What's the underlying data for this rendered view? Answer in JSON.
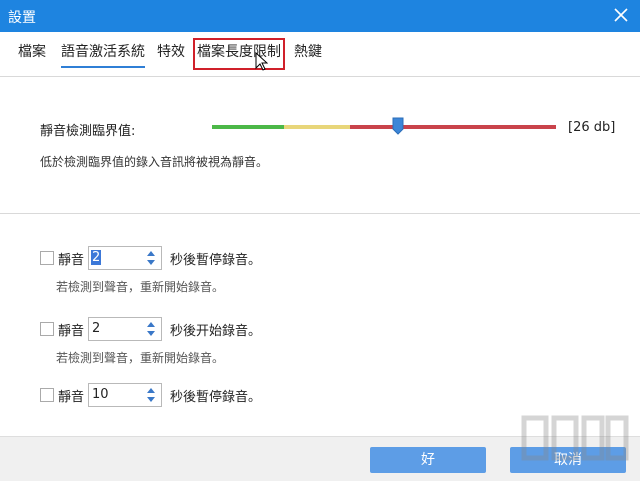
{
  "window": {
    "title": "設置"
  },
  "tabs": [
    {
      "label": "檔案"
    },
    {
      "label": "語音激活系統"
    },
    {
      "label": "特效"
    },
    {
      "label": "檔案長度限制"
    },
    {
      "label": "熱鍵"
    }
  ],
  "threshold": {
    "label": "靜音檢測臨界值:",
    "value_text": "[26 db]",
    "description": "低於檢測臨界值的錄入音訊將被視為靜音。"
  },
  "rows": [
    {
      "label": "靜音",
      "value": "2",
      "after": "秒後暫停錄音。",
      "hint": "若檢測到聲音，重新開始錄音。"
    },
    {
      "label": "靜音",
      "value": "2",
      "after": "秒後开始錄音。",
      "hint": "若檢測到聲音，重新開始錄音。"
    },
    {
      "label": "靜音",
      "value": "10",
      "after": "秒後暫停錄音。",
      "hint": ""
    }
  ],
  "buttons": {
    "ok": "好",
    "cancel": "取消"
  },
  "colors": {
    "titlebar": "#1e84e0",
    "accent": "#2f7fd6",
    "highlight": "#d0202a"
  }
}
